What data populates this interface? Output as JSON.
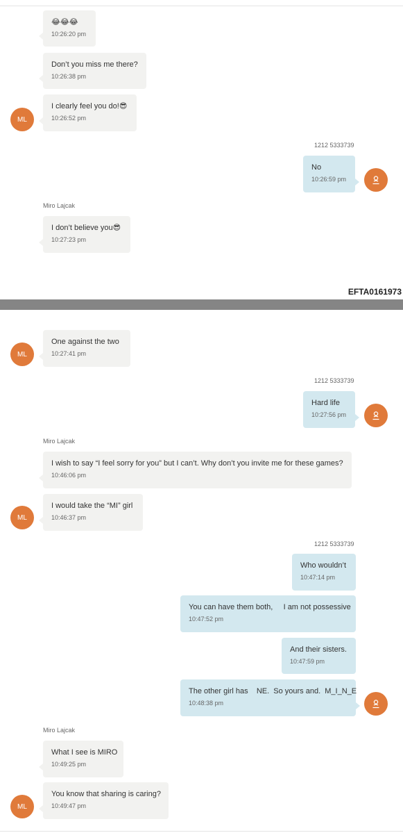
{
  "doc_id": "EFTA0161973",
  "contacts": {
    "in_initials": "ML",
    "in_name": "Miro Lajcak",
    "out_number": "1212 5333739",
    "out_avatar_icon": "person-icon"
  },
  "colors": {
    "avatar": "#e07a3a",
    "incoming_bubble": "#f2f2f0",
    "outgoing_bubble": "#d3e8ef",
    "separator": "#858585"
  },
  "messages": [
    {
      "dir": "in",
      "text": "😂😂😂",
      "time": "10:26:20 pm"
    },
    {
      "dir": "in",
      "text": "Don’t you miss me there?",
      "time": "10:26:38 pm"
    },
    {
      "dir": "in",
      "text": "I clearly feel you do!😎",
      "time": "10:26:52 pm"
    },
    {
      "dir": "out",
      "text": "No",
      "time": "10:26:59 pm"
    },
    {
      "dir": "in",
      "text": "I don’t believe you😎",
      "time": "10:27:23 pm"
    },
    {
      "dir": "in",
      "text": "One against the two",
      "time": "10:27:41 pm"
    },
    {
      "dir": "out",
      "text": "Hard life",
      "time": "10:27:56 pm"
    },
    {
      "dir": "in",
      "text": "I wish to say “I feel sorry for you” but I can’t. Why don’t you invite me for these games?",
      "time": "10:46:06 pm"
    },
    {
      "dir": "in",
      "text": "I would take the “MI” girl",
      "time": "10:46:37 pm"
    },
    {
      "dir": "out",
      "text": "Who wouldn’t",
      "time": "10:47:14 pm"
    },
    {
      "dir": "out",
      "text": "You can have them both,     I am not possessive",
      "time": "10:47:52 pm"
    },
    {
      "dir": "out",
      "text": "And their sisters.",
      "time": "10:47:59 pm"
    },
    {
      "dir": "out",
      "text": "The other girl has    NE.  So yours and.  M_I_N_E",
      "time": "10:48:38 pm"
    },
    {
      "dir": "in",
      "text": "What I see is MIRO",
      "time": "10:49:25 pm"
    },
    {
      "dir": "in",
      "text": "You know that sharing is caring?",
      "time": "10:49:47 pm"
    }
  ]
}
